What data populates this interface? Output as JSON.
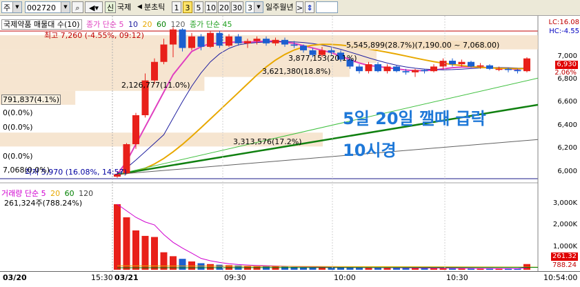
{
  "toolbar": {
    "mode_label": "주",
    "code_value": "002720",
    "credit_label": "신",
    "stock_name": "국제",
    "nav_prev": "◀",
    "interval_label": "분초틱",
    "interval_buttons": [
      "1",
      "3",
      "5",
      "10",
      "20",
      "30"
    ],
    "selected_interval": "3",
    "count_value": "3",
    "period_label": "일주월년",
    "nav_next": ">",
    "updown_icon": "updown-arrow-icon"
  },
  "price_panel": {
    "stock_title": "국제약품 매물대 수(10)",
    "ma_legend": [
      {
        "text": "종가 단순 5",
        "color": "#e040c0"
      },
      {
        "text": "10",
        "color": "#2020a0"
      },
      {
        "text": "20",
        "color": "#e8a800"
      },
      {
        "text": "60",
        "color": "#008000"
      },
      {
        "text": "120",
        "color": "#606060"
      }
    ],
    "ma45_legend": {
      "text": "종가 단순 45",
      "color": "#20a020"
    },
    "high_label": "최고 7,260 (-4.55%, 09:12)",
    "low_label": "최저 5,970 (16.08%, 14:57)",
    "lc_label": "LC:16.08",
    "hc_label": "HC:-4.55",
    "current_price": "6,930",
    "current_pct": "2.06%",
    "volume_profile": [
      {
        "text": "5,545,899(28.7%)(7,190.00 ~ 7,068.00)",
        "fraction": 1.0
      },
      {
        "text": "3,877,153(20.1%)",
        "fraction": 0.7
      },
      {
        "text": "3,621,380(18.8%)",
        "fraction": 0.65
      },
      {
        "text": "2,126,777(11.0%)",
        "fraction": 0.38
      },
      {
        "text": "791,837(4.1%)",
        "fraction": 0.14
      },
      {
        "text": "0(0.0%)",
        "fraction": 0
      },
      {
        "text": "0(0.0%)",
        "fraction": 0
      },
      {
        "text": "3,313,576(17.2%)",
        "fraction": 0.6
      },
      {
        "text": "0(0.0%)",
        "fraction": 0
      },
      {
        "text": "7,068(0.0%)",
        "fraction": 0
      }
    ],
    "y_ticks": [
      "7,000",
      "6,800",
      "6,600",
      "6,400",
      "6,200",
      "6,000"
    ],
    "annotation_line1": "5일 20일 깰때 급락",
    "annotation_line2": "10시경"
  },
  "volume_panel": {
    "title": "거래량 단순 5",
    "ma_labels": [
      {
        "text": "거래량 단순 5",
        "color": "#d000d0"
      },
      {
        "text": "20",
        "color": "#e8a800"
      },
      {
        "text": "60",
        "color": "#008000"
      },
      {
        "text": "120",
        "color": "#404040"
      }
    ],
    "current_label": "261,324주(788.24%)",
    "y_ticks": [
      "3,000K",
      "2,000K",
      "1,000K"
    ],
    "current_value_tag": "261.32",
    "current_pct_tag": "788.24"
  },
  "x_axis": {
    "labels": [
      "03/20",
      "15:30",
      "03/21",
      "09:30",
      "10:00",
      "10:30",
      "10:54:00"
    ]
  },
  "chart_data": {
    "type": "candlestick",
    "interval": "3분",
    "candles": [
      {
        "o": 5970,
        "h": 6010,
        "l": 5960,
        "c": 5990,
        "up": true
      },
      {
        "o": 6000,
        "h": 6260,
        "l": 5990,
        "c": 6250,
        "up": true
      },
      {
        "o": 6250,
        "h": 6520,
        "l": 6210,
        "c": 6500,
        "up": true
      },
      {
        "o": 6500,
        "h": 6860,
        "l": 6480,
        "c": 6800,
        "up": true
      },
      {
        "o": 6800,
        "h": 6990,
        "l": 6770,
        "c": 6960,
        "up": true
      },
      {
        "o": 6960,
        "h": 7160,
        "l": 6940,
        "c": 7110,
        "up": true
      },
      {
        "o": 7110,
        "h": 7260,
        "l": 7000,
        "c": 7240,
        "up": true
      },
      {
        "o": 7240,
        "h": 7250,
        "l": 7050,
        "c": 7080,
        "up": false
      },
      {
        "o": 7080,
        "h": 7210,
        "l": 7060,
        "c": 7180,
        "up": true
      },
      {
        "o": 7180,
        "h": 7200,
        "l": 7060,
        "c": 7090,
        "up": false
      },
      {
        "o": 7090,
        "h": 7230,
        "l": 7080,
        "c": 7210,
        "up": true
      },
      {
        "o": 7210,
        "h": 7230,
        "l": 7080,
        "c": 7100,
        "up": false
      },
      {
        "o": 7100,
        "h": 7200,
        "l": 7090,
        "c": 7180,
        "up": true
      },
      {
        "o": 7180,
        "h": 7200,
        "l": 7100,
        "c": 7120,
        "up": false
      },
      {
        "o": 7120,
        "h": 7160,
        "l": 7080,
        "c": 7140,
        "up": true
      },
      {
        "o": 7140,
        "h": 7180,
        "l": 7110,
        "c": 7160,
        "up": true
      },
      {
        "o": 7160,
        "h": 7180,
        "l": 7100,
        "c": 7120,
        "up": false
      },
      {
        "o": 7120,
        "h": 7170,
        "l": 7100,
        "c": 7150,
        "up": true
      },
      {
        "o": 7150,
        "h": 7170,
        "l": 7090,
        "c": 7110,
        "up": false
      },
      {
        "o": 7110,
        "h": 7140,
        "l": 7080,
        "c": 7100,
        "up": false
      },
      {
        "o": 7100,
        "h": 7110,
        "l": 7040,
        "c": 7060,
        "up": false
      },
      {
        "o": 7060,
        "h": 7080,
        "l": 7000,
        "c": 7020,
        "up": false
      },
      {
        "o": 7020,
        "h": 7090,
        "l": 7000,
        "c": 7060,
        "up": true
      },
      {
        "o": 7060,
        "h": 7080,
        "l": 7020,
        "c": 7040,
        "up": false
      },
      {
        "o": 7040,
        "h": 7060,
        "l": 6960,
        "c": 6980,
        "up": false
      },
      {
        "o": 6980,
        "h": 7000,
        "l": 6900,
        "c": 6920,
        "up": false
      },
      {
        "o": 6920,
        "h": 6940,
        "l": 6860,
        "c": 6880,
        "up": false
      },
      {
        "o": 6880,
        "h": 6960,
        "l": 6860,
        "c": 6940,
        "up": true
      },
      {
        "o": 6940,
        "h": 6960,
        "l": 6870,
        "c": 6880,
        "up": false
      },
      {
        "o": 6880,
        "h": 6940,
        "l": 6860,
        "c": 6920,
        "up": true
      },
      {
        "o": 6920,
        "h": 6930,
        "l": 6870,
        "c": 6880,
        "up": false
      },
      {
        "o": 6880,
        "h": 6900,
        "l": 6850,
        "c": 6870,
        "up": false
      },
      {
        "o": 6870,
        "h": 6900,
        "l": 6830,
        "c": 6890,
        "up": true
      },
      {
        "o": 6890,
        "h": 6900,
        "l": 6860,
        "c": 6880,
        "up": false
      },
      {
        "o": 6880,
        "h": 6940,
        "l": 6870,
        "c": 6920,
        "up": true
      },
      {
        "o": 6920,
        "h": 6990,
        "l": 6900,
        "c": 6970,
        "up": true
      },
      {
        "o": 6970,
        "h": 6990,
        "l": 6920,
        "c": 6940,
        "up": false
      },
      {
        "o": 6940,
        "h": 6980,
        "l": 6920,
        "c": 6960,
        "up": true
      },
      {
        "o": 6960,
        "h": 6970,
        "l": 6910,
        "c": 6920,
        "up": false
      },
      {
        "o": 6920,
        "h": 6950,
        "l": 6900,
        "c": 6930,
        "up": true
      },
      {
        "o": 6930,
        "h": 6940,
        "l": 6890,
        "c": 6900,
        "up": false
      },
      {
        "o": 6900,
        "h": 6920,
        "l": 6880,
        "c": 6900,
        "up": true
      },
      {
        "o": 6900,
        "h": 6910,
        "l": 6870,
        "c": 6890,
        "up": false
      },
      {
        "o": 6890,
        "h": 6900,
        "l": 6860,
        "c": 6880,
        "up": false
      },
      {
        "o": 6880,
        "h": 7000,
        "l": 6870,
        "c": 6990,
        "up": true
      }
    ],
    "volume_k": [
      3000,
      2400,
      1800,
      1550,
      1500,
      800,
      620,
      500,
      380,
      300,
      260,
      230,
      210,
      200,
      180,
      170,
      160,
      150,
      140,
      130,
      120,
      120,
      110,
      110,
      100,
      100,
      100,
      90,
      90,
      90,
      80,
      80,
      80,
      70,
      70,
      70,
      60,
      60,
      60,
      55,
      55,
      50,
      50,
      50,
      261
    ],
    "ma5": [
      5990,
      6100,
      6250,
      6400,
      6550,
      6700,
      6850,
      6950,
      7050,
      7090,
      7120,
      7120,
      7130,
      7130,
      7130,
      7135,
      7140,
      7140,
      7130,
      7120,
      7100,
      7080,
      7060,
      7040,
      7010,
      6980,
      6950,
      6930,
      6920,
      6910,
      6900,
      6890,
      6885,
      6885,
      6890,
      6900,
      6910,
      6915,
      6915,
      6915,
      6910,
      6905,
      6900,
      6895,
      6910
    ],
    "ma20_end": 6930,
    "ymin": 5900,
    "ymax": 7300
  }
}
